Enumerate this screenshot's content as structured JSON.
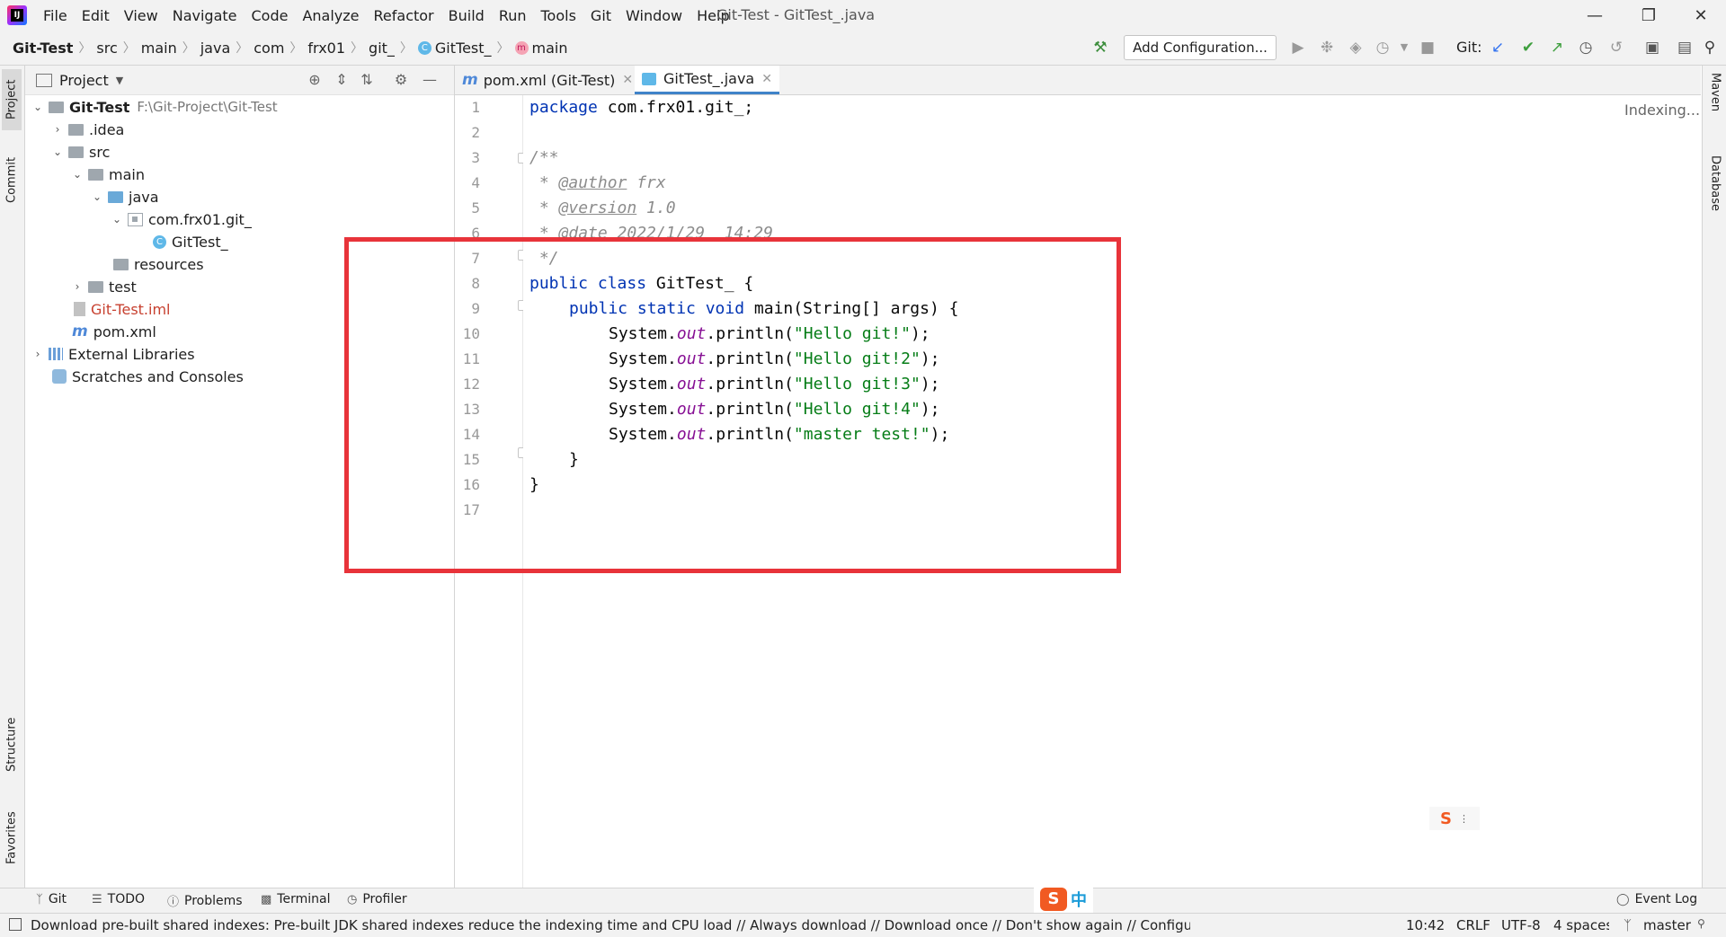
{
  "titlebar": {
    "menu": [
      "File",
      "Edit",
      "View",
      "Navigate",
      "Code",
      "Analyze",
      "Refactor",
      "Build",
      "Run",
      "Tools",
      "Git",
      "Window",
      "Help"
    ],
    "title": "Git-Test - GitTest_.java"
  },
  "navbar": {
    "crumbs": [
      "Git-Test",
      "src",
      "main",
      "java",
      "com",
      "frx01",
      "git_",
      "GitTest_",
      "main"
    ],
    "add_config": "Add Configuration...",
    "git_label": "Git:"
  },
  "left_stripe": {
    "project": "Project",
    "commit": "Commit",
    "structure": "Structure",
    "favorites": "Favorites"
  },
  "right_stripe": {
    "maven": "Maven",
    "database": "Database"
  },
  "project_panel": {
    "title": "Project",
    "tree": [
      {
        "label": "Git-Test",
        "suffix": "F:\\Git-Project\\Git-Test"
      },
      {
        "label": ".idea"
      },
      {
        "label": "src"
      },
      {
        "label": "main"
      },
      {
        "label": "java"
      },
      {
        "label": "com.frx01.git_"
      },
      {
        "label": "GitTest_"
      },
      {
        "label": "resources"
      },
      {
        "label": "test"
      },
      {
        "label": "Git-Test.iml"
      },
      {
        "label": "pom.xml"
      },
      {
        "label": "External Libraries"
      },
      {
        "label": "Scratches and Consoles"
      }
    ]
  },
  "editor": {
    "tabs": [
      {
        "label": "pom.xml (Git-Test)"
      },
      {
        "label": "GitTest_.java"
      }
    ],
    "indexing": "Indexing...",
    "line_numbers": [
      "1",
      "2",
      "3",
      "4",
      "5",
      "6",
      "7",
      "8",
      "9",
      "10",
      "11",
      "12",
      "13",
      "14",
      "15",
      "16",
      "17"
    ],
    "code": {
      "l1_kw": "package",
      "l1_rest": " com.frx01.git_;",
      "l3": "/**",
      "l4_star": " * ",
      "l4_tag": "@author",
      "l4_val": " frx",
      "l5_star": " * ",
      "l5_tag": "@version",
      "l5_val": " 1.0",
      "l6_star": " * ",
      "l6_tag": "@date",
      "l6_val": " 2022/1/29  14:29",
      "l7": " */",
      "l8_kw": "public class",
      "l8_rest": " GitTest_ {",
      "l9_kw": "public static void",
      "l9_rest": " main(String[] args) {",
      "sys": "System.",
      "out": "out",
      "println": ".println(",
      "s10": "\"Hello git!\"",
      "s11": "\"Hello git!2\"",
      "s12": "\"Hello git!3\"",
      "s13": "\"Hello git!4\"",
      "s14": "\"master test!\"",
      "end": ");",
      "l15": "}",
      "l16": "}"
    }
  },
  "toolwindows": {
    "git": "Git",
    "todo": "TODO",
    "problems": "Problems",
    "terminal": "Terminal",
    "profiler": "Profiler",
    "event_log": "Event Log"
  },
  "ime": {
    "glyph": "中"
  },
  "statusbar": {
    "message": "Download pre-built shared indexes: Pre-built JDK shared indexes reduce the indexing time and CPU load // Always download // Download once // Don't show again // Configure...",
    "position": "10:42",
    "line_sep": "CRLF",
    "encoding": "UTF-8",
    "indent": "4 spaces",
    "branch": "master"
  },
  "colors": {
    "highlight": "#e8333a",
    "keyword": "#0033b3",
    "string": "#067d17",
    "comment": "#8c8c8c",
    "tab_accent": "#4083c9"
  }
}
